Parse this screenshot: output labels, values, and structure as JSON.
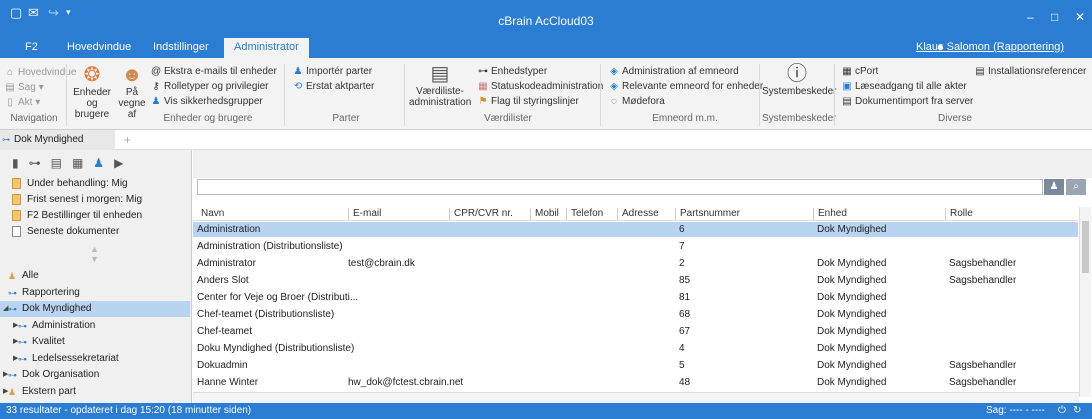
{
  "window": {
    "title": "cBrain AcCloud03"
  },
  "menu_tabs": [
    "F2",
    "Hovedvindue",
    "Indstillinger",
    "Administrator"
  ],
  "user": {
    "name": "Klaus Salomon (Rapportering)"
  },
  "ribbon": {
    "navigation": {
      "items": [
        "Hovedvindue",
        "Sag",
        "Akt"
      ],
      "group": "Navigation"
    },
    "enheder": {
      "big1": "Enheder og brugere",
      "big2": "På vegne af",
      "items": [
        "Ekstra e-mails til enheder",
        "Rolletyper og privilegier",
        "Vis sikkerhedsgrupper"
      ],
      "group": "Enheder og brugere"
    },
    "parter": {
      "items": [
        "Importér parter",
        "Erstat aktparter"
      ],
      "group": "Parter"
    },
    "vaerdilister": {
      "big": "Værdiliste-administration",
      "items": [
        "Enhedstyper",
        "Statuskodeadministration",
        "Flag til styringslinjer"
      ],
      "group": "Værdilister"
    },
    "emneord": {
      "items": [
        "Administration af emneord",
        "Relevante emneord for enheder",
        "Mødefora"
      ],
      "group": "Emneord m.m."
    },
    "system": {
      "big": "Systembeskeder",
      "group": "Systembeskeder"
    },
    "diverse": {
      "items": [
        "cPort",
        "Læseadgang til alle akter",
        "Dokumentimport fra server",
        "Installationsreferencer"
      ],
      "group": "Diverse"
    }
  },
  "doc_tab": {
    "label": "Dok Myndighed",
    "add": "+"
  },
  "favorites": [
    "Under behandling: Mig",
    "Frist senest i morgen: Mig",
    "F2 Bestillinger til enheden",
    "Seneste dokumenter"
  ],
  "tree": [
    {
      "label": "Alle",
      "level": 0,
      "twisty": ""
    },
    {
      "label": "Rapportering",
      "level": 0,
      "twisty": ""
    },
    {
      "label": "Dok Myndighed",
      "level": 0,
      "twisty": "◢"
    },
    {
      "label": "Administration",
      "level": 1,
      "twisty": "▶"
    },
    {
      "label": "Kvalitet",
      "level": 1,
      "twisty": "▶"
    },
    {
      "label": "Ledelsessekretariat",
      "level": 1,
      "twisty": "▶"
    },
    {
      "label": "Dok Organisation",
      "level": 0,
      "twisty": "▶"
    },
    {
      "label": "Ekstern part",
      "level": 0,
      "twisty": "▶"
    }
  ],
  "columns": [
    "Navn",
    "E-mail",
    "CPR/CVR nr.",
    "Mobil",
    "Telefon",
    "Adresse",
    "Partsnummer",
    "Enhed",
    "Rolle"
  ],
  "rows": [
    {
      "navn": "Administration",
      "email": "",
      "nr": "6",
      "enhed": "Dok Myndighed",
      "rolle": ""
    },
    {
      "navn": "Administration (Distributionsliste)",
      "email": "",
      "nr": "7",
      "enhed": "",
      "rolle": ""
    },
    {
      "navn": "Administrator",
      "email": "test@cbrain.dk",
      "nr": "2",
      "enhed": "Dok Myndighed",
      "rolle": "Sagsbehandler"
    },
    {
      "navn": "Anders Slot",
      "email": "",
      "nr": "85",
      "enhed": "Dok Myndighed",
      "rolle": "Sagsbehandler"
    },
    {
      "navn": "Center for Veje og Broer (Distributi...",
      "email": "",
      "nr": "81",
      "enhed": "Dok Myndighed",
      "rolle": ""
    },
    {
      "navn": "Chef-teamet (Distributionsliste)",
      "email": "",
      "nr": "68",
      "enhed": "Dok Myndighed",
      "rolle": ""
    },
    {
      "navn": "Chef-teamet",
      "email": "",
      "nr": "67",
      "enhed": "Dok Myndighed",
      "rolle": ""
    },
    {
      "navn": "Doku Myndighed (Distributionsliste)",
      "email": "",
      "nr": "4",
      "enhed": "Dok Myndighed",
      "rolle": ""
    },
    {
      "navn": "Dokuadmin",
      "email": "",
      "nr": "5",
      "enhed": "Dok Myndighed",
      "rolle": "Sagsbehandler"
    },
    {
      "navn": "Hanne Winter",
      "email": "hw_dok@fctest.cbrain.net",
      "nr": "48",
      "enhed": "Dok Myndighed",
      "rolle": "Sagsbehandler"
    }
  ],
  "status": {
    "left": "33 resultater - opdateret i dag 15:20 (18 minutter siden)",
    "right": "Sag: ---- - ----"
  }
}
